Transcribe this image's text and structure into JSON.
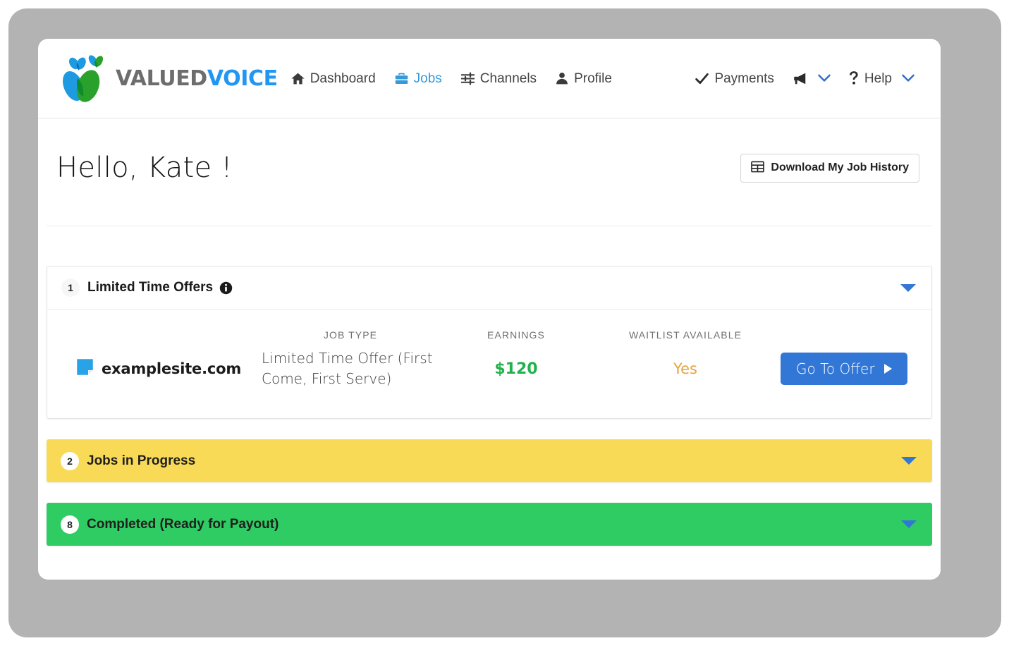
{
  "brand": {
    "name_part1": "VALUED",
    "name_part2": "VOICE",
    "logo_icon": "valuedvoice-leaf-logo",
    "color_blue": "#2196f3",
    "color_green": "#2aa12a",
    "color_gray_text": "#6d6d6d"
  },
  "nav": {
    "left_items": [
      {
        "label": "Dashboard",
        "icon": "home-icon",
        "active": false
      },
      {
        "label": "Jobs",
        "icon": "briefcase-icon",
        "active": true
      },
      {
        "label": "Channels",
        "icon": "sliders-icon",
        "active": false
      },
      {
        "label": "Profile",
        "icon": "user-icon",
        "active": false
      }
    ],
    "right_items": [
      {
        "label": "Payments",
        "icon": "check-icon",
        "has_chevron": false
      },
      {
        "label": "",
        "icon": "megaphone-icon",
        "has_chevron": true
      },
      {
        "label": "Help",
        "icon": "question-mark-icon",
        "has_chevron": true
      }
    ]
  },
  "greeting": {
    "text": "Hello, Kate !",
    "download_button": {
      "label": "Download My Job History",
      "icon": "table-grid-icon"
    }
  },
  "sections": [
    {
      "count": "1",
      "title": "Limited Time Offers",
      "has_info_icon": true,
      "info_icon": "info-circle-icon",
      "chevron_icon": "chevron-down-icon",
      "expanded": true,
      "bar_color": "#ffffff"
    },
    {
      "count": "2",
      "title": "Jobs in Progress",
      "has_info_icon": false,
      "chevron_icon": "chevron-down-icon",
      "expanded": false,
      "bar_color": "#f9da57"
    },
    {
      "count": "8",
      "title": "Completed (Ready for Payout)",
      "has_info_icon": false,
      "chevron_icon": "chevron-down-icon",
      "expanded": false,
      "bar_color": "#2ecc62"
    }
  ],
  "offers_table": {
    "columns": [
      "",
      "JOB TYPE",
      "EARNINGS",
      "WAITLIST AVAILABLE",
      ""
    ],
    "rows": [
      {
        "site_icon": "sticky-note-icon",
        "site_name": "examplesite.com",
        "job_type": "Limited Time Offer (First Come, First Serve)",
        "earnings": "$120",
        "earnings_color": "#22b14c",
        "waitlist_available": "Yes",
        "waitlist_color": "#e8a33d",
        "action_label": "Go To Offer",
        "action_icon": "play-arrow-icon"
      }
    ]
  }
}
